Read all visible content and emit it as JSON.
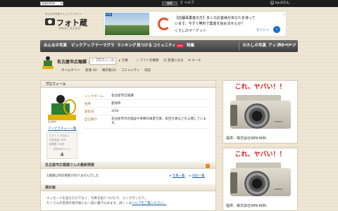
{
  "topbar": {
    "language": "Japanese",
    "search_label": "検索",
    "help": "ヘルプ",
    "user": "kyu3さん"
  },
  "header": {
    "tagline": "みんなの写真コミュニティサイト",
    "logo": "フォト蔵",
    "logo_sub": "PHOTOZOU"
  },
  "ad_banner": {
    "badge": "広告",
    "line1": "【店舗事業者の方】多くのお客様があなたを待って",
    "line2": "います。今すぐ無料で集客を始めませんか？",
    "line3": "くらしのマーケット",
    "site_label": "サイトへ"
  },
  "nav": {
    "items": [
      "みんなの写真",
      "ピックアップ",
      "テーマグラ",
      "ランキング",
      "見つける",
      "コミュニティ",
      "特集"
    ],
    "new_badge": "new",
    "right_items": [
      "わたしの写真",
      "アップロード",
      "マイページ"
    ]
  },
  "user": {
    "name": "名古屋市広報課",
    "honorific": "さん",
    "tabs": [
      "プロフィール",
      "写真",
      "ファンを解除",
      "友達になる",
      "メール"
    ],
    "sub_tabs": [
      "タイムライン",
      "友達 (0)",
      "掲示板(3)",
      "コミュニティ",
      "日記"
    ]
  },
  "profile": {
    "section_title": "プロフィール",
    "photo_tag": "名古屋市",
    "link": "マイピクチャー一覧",
    "stats": [
      "ログイン: 8日以上",
      "写真容量: 6GB",
      "総枚数: 92枚"
    ],
    "today_label": "今日のポイント",
    "today_value": "4",
    "fields": [
      {
        "key": "ニックネーム",
        "value": "名古屋市広報課"
      },
      {
        "key": "住所",
        "value": "愛知県"
      },
      {
        "key": "誕生日",
        "value": "3/18"
      },
      {
        "key": "自己紹介",
        "value": "名古屋市内の施設や季節の風景写真、航空写真などを公開しています。"
      }
    ]
  },
  "news": {
    "section_title": "名古屋市広報課さんの最新情報",
    "empty_text": "1週間以内の更新がありませんでした",
    "link_photos": "写真一覧",
    "link_diary": "日記一覧"
  },
  "board": {
    "section_title": "掲示板",
    "line1": "メッセージを送るだけでなく、写真を貼りつけたり、らくがきしたり。",
    "line2_prefix": "たくさんの友達の掲示板にも一度に書き込めます。詳しくは",
    "line2_link": "ヘルプをご覧ください。"
  },
  "side_ads": [
    {
      "headline": "これ、ヤバい！！",
      "caption": "提供：株式会社WIN-WIN",
      "brand": "CONTAX"
    },
    {
      "headline": "これ、ヤバい！！",
      "caption": "提供：株式会社WIN-WIN",
      "brand": "CONTAX"
    }
  ]
}
